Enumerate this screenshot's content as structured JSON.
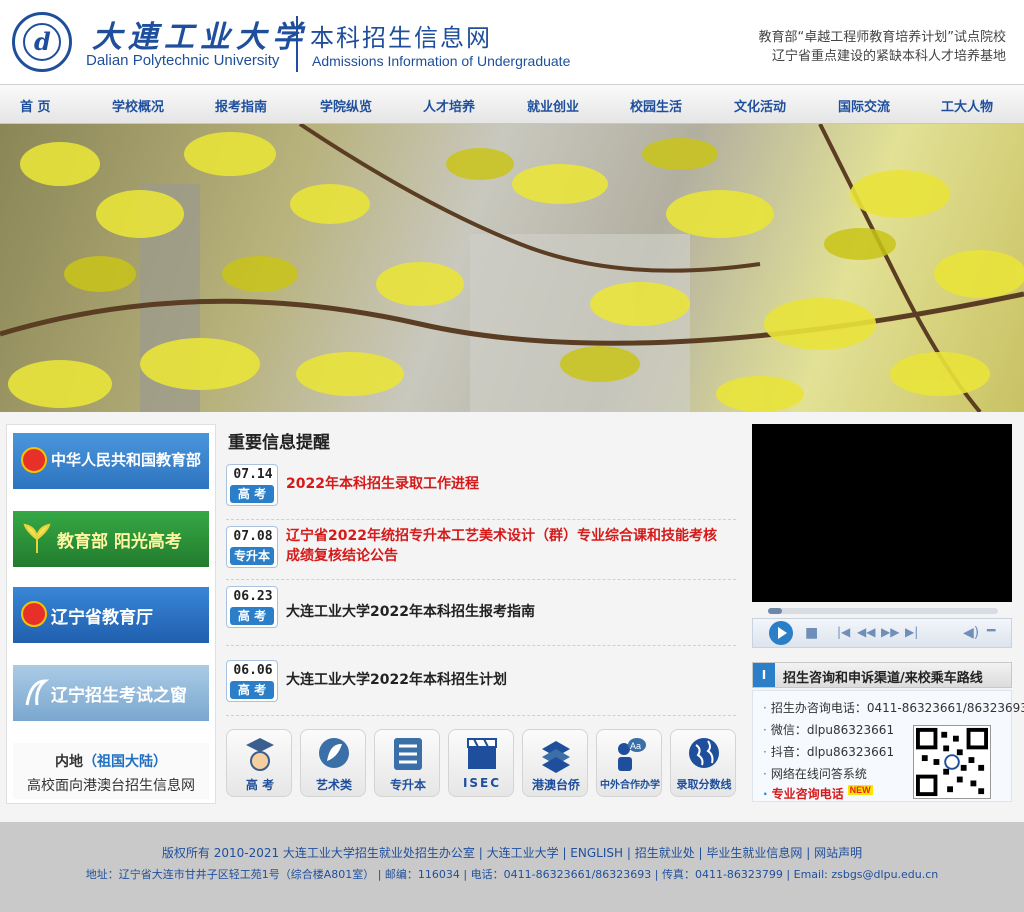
{
  "header": {
    "university_cn": "大連工业大学",
    "university_en": "Dalian Polytechnic University",
    "site_title_cn": "本科招生信息网",
    "site_title_en": "Admissions Information of Undergraduate",
    "slogan_line1": "教育部“卓越工程师教育培养计划”试点院校",
    "slogan_line2": "辽宁省重点建设的紧缺本科人才培养基地",
    "logo_icon": "dpu-seal-logo"
  },
  "nav": {
    "items": [
      "首  页",
      "学校概况",
      "报考指南",
      "学院纵览",
      "人才培养",
      "就业创业",
      "校园生活",
      "文化活动",
      "国际交流",
      "工大人物"
    ]
  },
  "sidebar": {
    "links": [
      {
        "label": "中华人民共和国教育部",
        "color": "#2f7fc9"
      },
      {
        "label": "教育部 阳光高考",
        "color": "#2e9a3c"
      },
      {
        "label": "辽宁省教育厅",
        "color": "#1f6fbf"
      },
      {
        "label": "辽宁招生考试之窗",
        "color": "#8fb8d8"
      }
    ],
    "hk": {
      "line1_prefix": "内地",
      "line1_paren": "（祖国大陆）",
      "line2": "高校面向港澳台招生信息网"
    }
  },
  "news": {
    "heading": "重要信息提醒",
    "items": [
      {
        "date": "07.14",
        "category": "高 考",
        "title": "2022年本科招生录取工作进程",
        "color": "#d41a1a"
      },
      {
        "date": "07.08",
        "category": "专升本",
        "title": "辽宁省2022年统招专升本工艺美术设计（群）专业综合课和技能考核成绩复核结论公告",
        "color": "#d41a1a"
      },
      {
        "date": "06.23",
        "category": "高 考",
        "title": "大连工业大学2022年本科招生报考指南",
        "color": "#222222"
      },
      {
        "date": "06.06",
        "category": "高 考",
        "title": "大连工业大学2022年本科招生计划",
        "color": "#222222"
      }
    ]
  },
  "quick_links": [
    {
      "label": "高 考",
      "icon": "graduate-cap-icon"
    },
    {
      "label": "艺术类",
      "icon": "leaf-art-icon"
    },
    {
      "label": "专升本",
      "icon": "ladder-icon"
    },
    {
      "label": "ISEC",
      "icon": "clapper-icon"
    },
    {
      "label": "港澳台侨",
      "icon": "books-icon"
    },
    {
      "label": "中外合作办学",
      "icon": "speech-aa-icon"
    },
    {
      "label": "录取分数线",
      "icon": "globe-icon"
    }
  ],
  "player": {
    "progress": 0.06
  },
  "contact": {
    "heading": "招生咨询和申诉渠道/来校乘车路线",
    "phone": "招生办咨询电话：0411-86323661/86323693",
    "wechat": "微信：dlpu86323661",
    "douyin": "抖音：dlpu86323661",
    "online": "网络在线问答系统",
    "hotline": "专业咨询电话",
    "new_tag": "NEW"
  },
  "footer": {
    "line1": [
      "版权所有 2010-2021 大连工业大学招生就业处招生办公室",
      "大连工业大学",
      "ENGLISH",
      "招生就业处",
      "毕业生就业信息网",
      "网站声明"
    ],
    "line2": "地址：辽宁省大连市甘井子区轻工苑1号（综合楼A801室） | 邮编：116034 | 电话：0411-86323661/86323693 | 传真：0411-86323799 | Email: zsbgs@dlpu.edu.cn"
  }
}
